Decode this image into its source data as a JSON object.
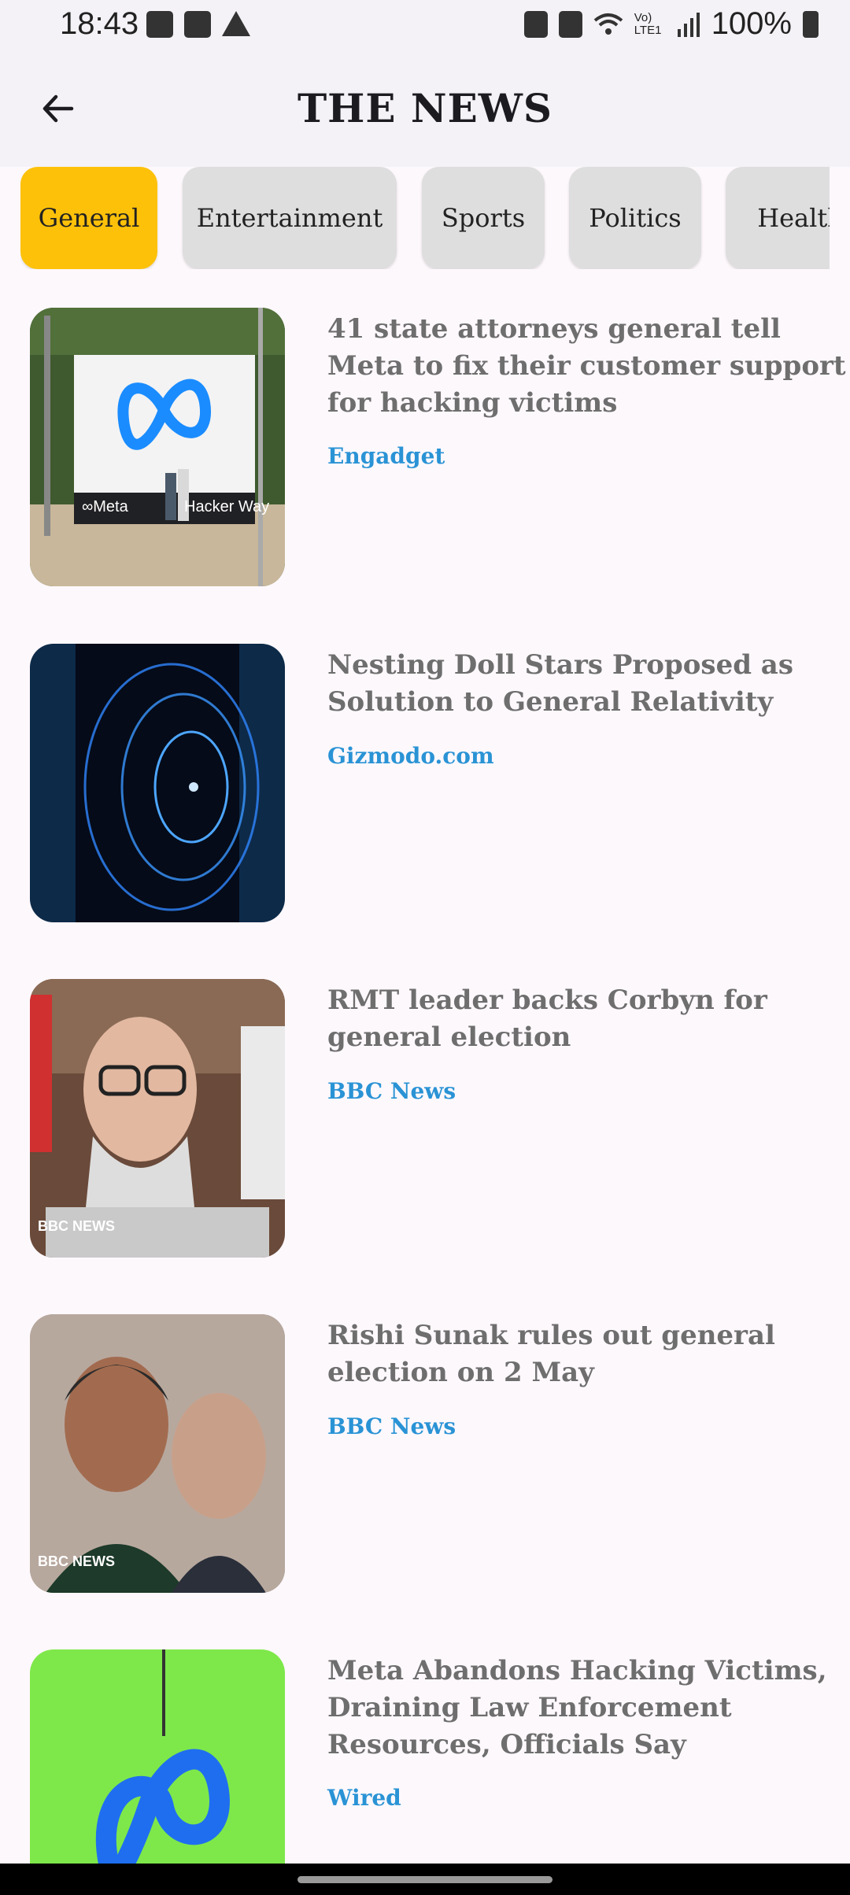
{
  "status_bar": {
    "time": "18:43",
    "left_icons": [
      "image-icon",
      "calendar-icon",
      "warning-icon"
    ],
    "right_icons": [
      "battery-saver-icon",
      "mute-icon",
      "wifi-icon",
      "volte-icon",
      "signal-icon"
    ],
    "volte_label": "Vo) LTE1",
    "battery_percent": "100%"
  },
  "app_bar": {
    "back_icon": "arrow-left-icon",
    "title": "THE NEWS"
  },
  "categories": {
    "active": "General",
    "items": [
      "General",
      "Entertainment",
      "Sports",
      "Politics",
      "Health"
    ]
  },
  "articles": [
    {
      "title": "41 state attorneys general tell Meta to fix their customer support for hacking victims",
      "source": "Engadget",
      "thumb_sign_left": "∞Meta",
      "thumb_sign_right": "Hacker Way"
    },
    {
      "title": "Nesting Doll Stars Proposed as Solution to General Relativity",
      "source": "Gizmodo.com"
    },
    {
      "title": "RMT leader backs Corbyn for general election",
      "source": "BBC News",
      "thumb_logo": "BBC NEWS"
    },
    {
      "title": "Rishi Sunak rules out general election on 2 May",
      "source": "BBC News",
      "thumb_logo": "BBC NEWS"
    },
    {
      "title": "Meta Abandons Hacking Victims, Draining Law Enforcement Resources, Officials Say",
      "source": "Wired"
    }
  ],
  "colors": {
    "accent": "#fdc10a",
    "chip": "#dedede",
    "source_link": "#2a93d5",
    "title_text": "#6e6e6e",
    "background": "#fdf8fc"
  }
}
